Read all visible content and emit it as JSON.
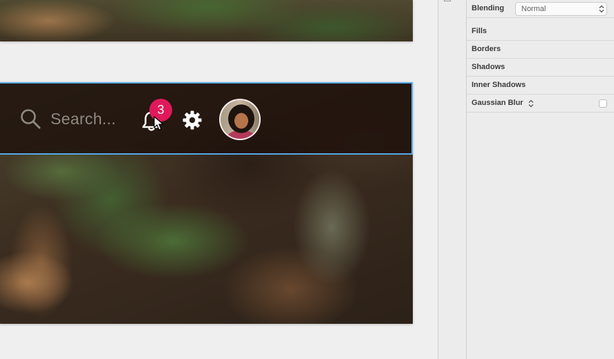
{
  "toolbar": {
    "search_placeholder": "Search...",
    "notification_count": "3",
    "accent_border_color": "#58a9e6",
    "badge_color": "#e0195a"
  },
  "inspector": {
    "blending": {
      "label": "Blending",
      "value": "Normal"
    },
    "sections": [
      "Fills",
      "Borders",
      "Shadows",
      "Inner Shadows"
    ],
    "gaussian_blur": {
      "label": "Gaussian Blur",
      "enabled": false
    }
  },
  "icons": [
    "search-icon",
    "bell-icon",
    "gear-icon",
    "cursor-icon",
    "updown-icon"
  ]
}
